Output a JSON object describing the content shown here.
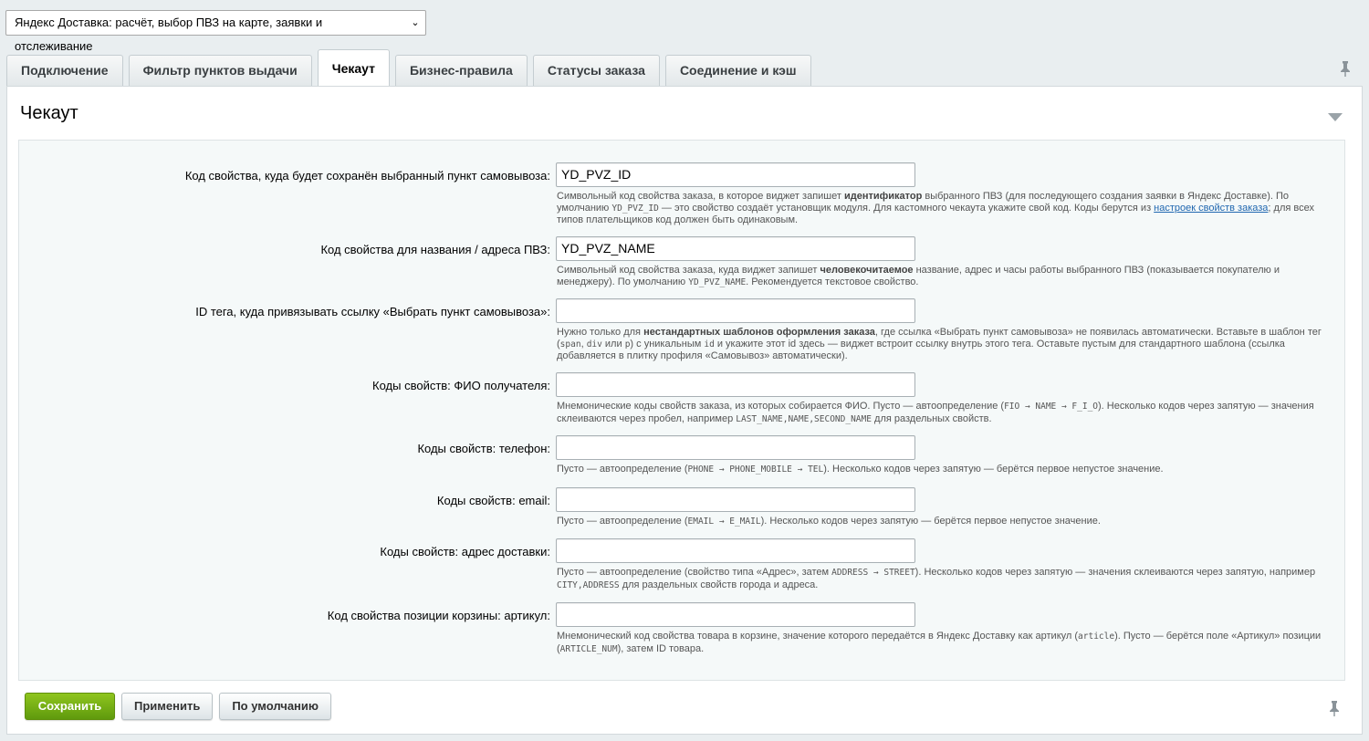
{
  "module_select": {
    "value": "Яндекс Доставка: расчёт, выбор ПВЗ на карте, заявки и отслеживание"
  },
  "tabs": [
    {
      "label": "Подключение",
      "active": false
    },
    {
      "label": "Фильтр пунктов выдачи",
      "active": false
    },
    {
      "label": "Чекаут",
      "active": true
    },
    {
      "label": "Бизнес-правила",
      "active": false
    },
    {
      "label": "Статусы заказа",
      "active": false
    },
    {
      "label": "Соединение и кэш",
      "active": false
    }
  ],
  "panel": {
    "title": "Чекаут"
  },
  "fields": {
    "pvz_id": {
      "label": "Код свойства, куда будет сохранён выбранный пункт самовывоза:",
      "value": "YD_PVZ_ID",
      "hint_1": "Символьный код свойства заказа, в которое виджет запишет ",
      "hint_bold": "идентификатор",
      "hint_2": " выбранного ПВЗ (для последующего создания заявки в Яндекс Доставке). По умолчанию ",
      "hint_code": "YD_PVZ_ID",
      "hint_3": " — это свойство создаёт установщик модуля. Для кастомного чекаута укажите свой код. Коды берутся из ",
      "hint_link": "настроек свойств заказа",
      "hint_4": "; для всех типов плательщиков код должен быть одинаковым."
    },
    "pvz_name": {
      "label": "Код свойства для названия / адреса ПВЗ:",
      "value": "YD_PVZ_NAME",
      "hint_1": "Символьный код свойства заказа, куда виджет запишет ",
      "hint_bold": "человекочитаемое",
      "hint_2": " название, адрес и часы работы выбранного ПВЗ (показывается покупателю и менеджеру). По умолчанию ",
      "hint_code": "YD_PVZ_NAME",
      "hint_3": ". Рекомендуется текстовое свойство."
    },
    "tag_id": {
      "label": "ID тега, куда привязывать ссылку «Выбрать пункт самовывоза»:",
      "value": "",
      "hint_1": "Нужно только для ",
      "hint_bold": "нестандартных шаблонов оформления заказа",
      "hint_2": ", где ссылка «Выбрать пункт самовывоза» не появилась автоматически. Вставьте в шаблон тег (",
      "hint_code_1": "span",
      "hint_3": ", ",
      "hint_code_2": "div",
      "hint_4": " или ",
      "hint_code_3": "p",
      "hint_5": ") с уникальным ",
      "hint_code_4": "id",
      "hint_6": " и укажите этот id здесь — виджет встроит ссылку внутрь этого тега. Оставьте пустым для стандартного шаблона (ссылка добавляется в плитку профиля «Самовывоз» автоматически)."
    },
    "fio": {
      "label": "Коды свойств: ФИО получателя:",
      "value": "",
      "hint_1": "Мнемонические коды свойств заказа, из которых собирается ФИО. Пусто — автоопределение (",
      "hint_code_1": "FIO → NAME → F_I_O",
      "hint_2": "). Несколько кодов через запятую — значения склеиваются через пробел, например ",
      "hint_code_2": "LAST_NAME,NAME,SECOND_NAME",
      "hint_3": " для раздельных свойств."
    },
    "phone": {
      "label": "Коды свойств: телефон:",
      "value": "",
      "hint_1": "Пусто — автоопределение (",
      "hint_code_1": "PHONE → PHONE_MOBILE → TEL",
      "hint_2": "). Несколько кодов через запятую — берётся первое непустое значение."
    },
    "email": {
      "label": "Коды свойств: email:",
      "value": "",
      "hint_1": "Пусто — автоопределение (",
      "hint_code_1": "EMAIL → E_MAIL",
      "hint_2": "). Несколько кодов через запятую — берётся первое непустое значение."
    },
    "address": {
      "label": "Коды свойств: адрес доставки:",
      "value": "",
      "hint_1": "Пусто — автоопределение (свойство типа «Адрес», затем ",
      "hint_code_1": "ADDRESS → STREET",
      "hint_2": "). Несколько кодов через запятую — значения склеиваются через запятую, например ",
      "hint_code_2": "CITY,ADDRESS",
      "hint_3": " для раздельных свойств города и адреса."
    },
    "article": {
      "label": "Код свойства позиции корзины: артикул:",
      "value": "",
      "hint_1": "Мнемонический код свойства товара в корзине, значение которого передаётся в Яндекс Доставку как артикул (",
      "hint_code_1": "article",
      "hint_2": "). Пусто — берётся поле «Артикул» позиции (",
      "hint_code_2": "ARTICLE_NUM",
      "hint_3": "), затем ID товара."
    }
  },
  "buttons": {
    "save": "Сохранить",
    "apply": "Применить",
    "defaults": "По умолчанию"
  },
  "colors": {
    "primary_button": "#6faa12",
    "link": "#2067b0",
    "background": "#e9eef0"
  },
  "icons": {
    "pin": "pin-icon",
    "collapse": "triangle-down-icon",
    "select_arrow": "chevron-down-icon"
  }
}
